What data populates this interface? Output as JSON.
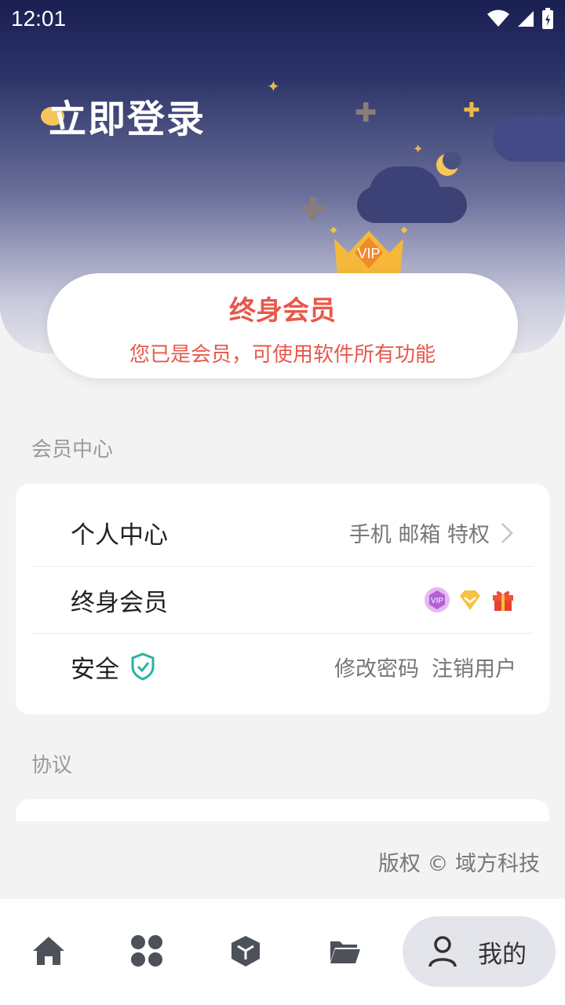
{
  "status_bar": {
    "time": "12:01"
  },
  "header": {
    "login_label": "立即登录"
  },
  "member_card": {
    "title": "终身会员",
    "subtitle": "您已是会员，可使用软件所有功能",
    "badge_text": "VIP",
    "accent_color": "#e8584b"
  },
  "member_center": {
    "section_label": "会员中心",
    "rows": [
      {
        "label": "个人中心",
        "right_text": "手机 邮箱 特权"
      },
      {
        "label": "终身会员",
        "badges": [
          "vip-badge-icon",
          "diamond-icon",
          "gift-icon"
        ]
      },
      {
        "label": "安全",
        "right_links": [
          "修改密码",
          "注销用户"
        ]
      }
    ]
  },
  "agreement": {
    "section_label": "协议"
  },
  "footer": {
    "copyright": "版权 © 域方科技"
  },
  "bottom_nav": {
    "items": [
      "home-icon",
      "apps-icon",
      "cube-icon",
      "folder-icon"
    ],
    "active": {
      "icon": "user-icon",
      "label": "我的"
    }
  }
}
